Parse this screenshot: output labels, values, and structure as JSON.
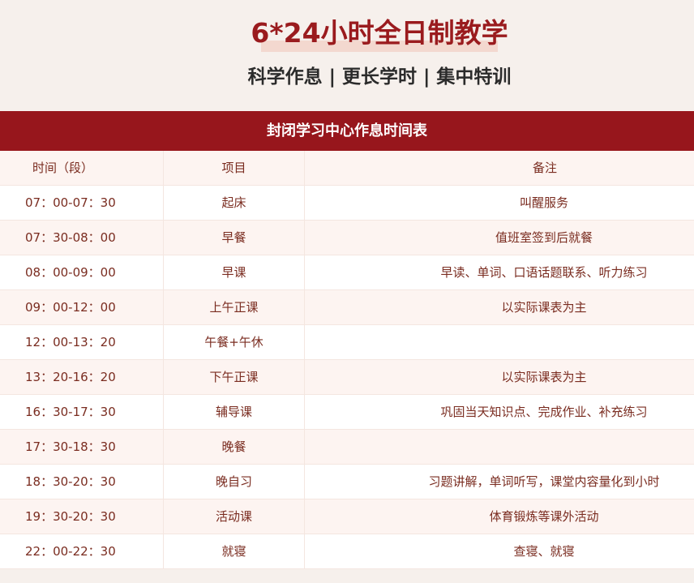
{
  "header": {
    "title": "6*24小时全日制教学",
    "subtitle": "科学作息 | 更长学时 | 集中特训"
  },
  "table": {
    "caption": "封闭学习中心作息时间表",
    "columns": [
      "时间（段）",
      "项目",
      "备注"
    ],
    "rows": [
      [
        "07：00-07：30",
        "起床",
        "叫醒服务"
      ],
      [
        "07：30-08：00",
        "早餐",
        "值班室签到后就餐"
      ],
      [
        "08：00-09：00",
        "早课",
        "早读、单词、口语话题联系、听力练习"
      ],
      [
        "09：00-12：00",
        "上午正课",
        "以实际课表为主"
      ],
      [
        "12：00-13：20",
        "午餐+午休",
        ""
      ],
      [
        "13：20-16：20",
        "下午正课",
        "以实际课表为主"
      ],
      [
        "16：30-17：30",
        "辅导课",
        "巩固当天知识点、完成作业、补充练习"
      ],
      [
        "17：30-18：30",
        "晚餐",
        ""
      ],
      [
        "18：30-20：30",
        "晚自习",
        "习题讲解，单词听写，课堂内容量化到小时"
      ],
      [
        "19：30-20：30",
        "活动课",
        "体育锻炼等课外活动"
      ],
      [
        "22：00-22：30",
        "就寝",
        "查寝、就寝"
      ]
    ]
  },
  "colors": {
    "accent": "#97161c",
    "title": "#9a1b1e",
    "cell_text": "#7a2c20",
    "background": "#f6f0ec"
  }
}
